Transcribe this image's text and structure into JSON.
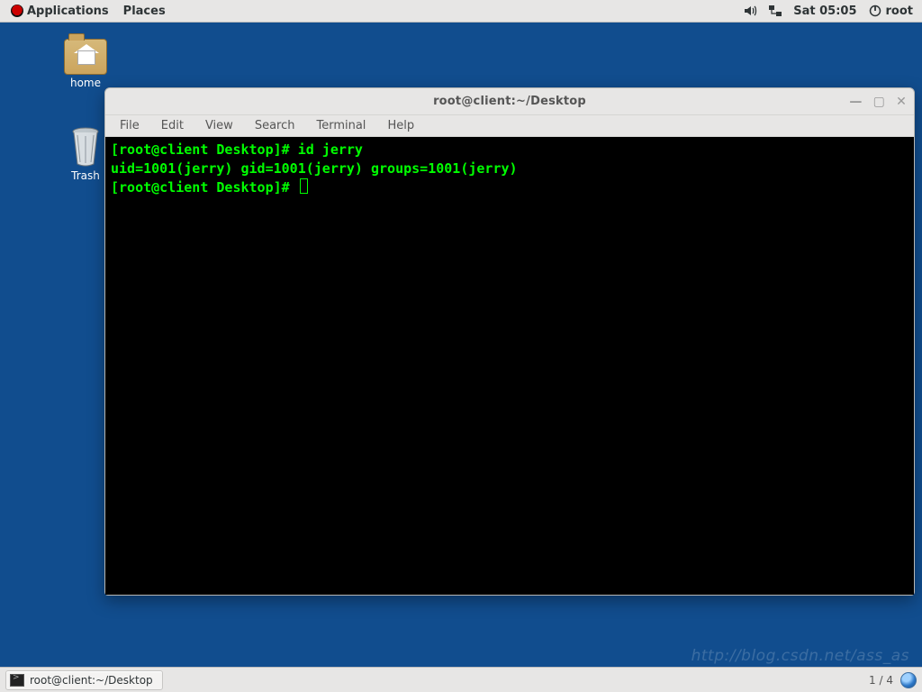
{
  "topbar": {
    "applications": "Applications",
    "places": "Places",
    "clock": "Sat 05:05",
    "user": "root"
  },
  "desktop": {
    "home_label": "home",
    "trash_label": "Trash"
  },
  "terminal": {
    "title": "root@client:~/Desktop",
    "menu": {
      "file": "File",
      "edit": "Edit",
      "view": "View",
      "search": "Search",
      "terminal": "Terminal",
      "help": "Help"
    },
    "prompt1": "[root@client Desktop]# ",
    "cmd1": "id jerry",
    "output1": "uid=1001(jerry) gid=1001(jerry) groups=1001(jerry)",
    "prompt2": "[root@client Desktop]# "
  },
  "taskbar": {
    "task_label": "root@client:~/Desktop",
    "workspace": "1 / 4"
  },
  "watermark": "http://blog.csdn.net/ass_as"
}
